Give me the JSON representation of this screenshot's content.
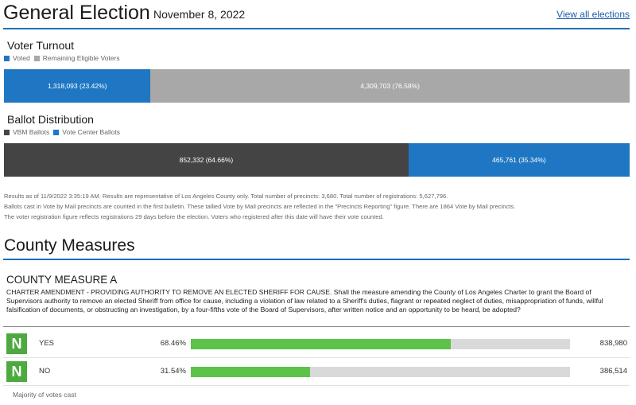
{
  "header": {
    "title": "General Election",
    "date": "November 8, 2022",
    "view_all": "View all elections"
  },
  "turnout": {
    "title": "Voter Turnout",
    "legend": [
      {
        "label": "Voted",
        "color": "#1f77c4"
      },
      {
        "label": "Remaining Eligible Voters",
        "color": "#a8a8a8"
      }
    ],
    "segments": [
      {
        "label": "1,318,093 (23.42%)",
        "fraction": 0.2342,
        "color": "#1f77c4"
      },
      {
        "label": "4,309,703 (76.58%)",
        "fraction": 0.7658,
        "color": "#a8a8a8"
      }
    ]
  },
  "distribution": {
    "title": "Ballot Distribution",
    "legend": [
      {
        "label": "VBM Ballots",
        "color": "#444444"
      },
      {
        "label": "Vote Center Ballots",
        "color": "#1f77c4"
      }
    ],
    "segments": [
      {
        "label": "852,332 (64.66%)",
        "fraction": 0.6466,
        "color": "#444444"
      },
      {
        "label": "465,761 (35.34%)",
        "fraction": 0.3534,
        "color": "#1f77c4"
      }
    ]
  },
  "notes": [
    "Results as of 11/9/2022 3:35:19 AM. Results are representative of Los Angeles County only. Total number of precincts: 3,680. Total number of registrations: 5,627,796.",
    "Ballots cast in Vote by Mail precincts are counted in the first bulletin. These tallied Vote by Mail precincts are reflected in the \"Precincts Reporting\" figure. There are 1864 Vote by Mail precincts.",
    "The voter registration figure reflects registrations 29 days before the election. Voters who registered after this date will have their vote counted."
  ],
  "measures": {
    "title": "County Measures",
    "measure": {
      "name": "COUNTY MEASURE A",
      "description": "CHARTER AMENDMENT - PROVIDING AUTHORITY TO REMOVE AN ELECTED SHERIFF FOR CAUSE. Shall the measure amending the County of Los Angeles Charter to grant the Board of Supervisors authority to remove an elected Sheriff from office for cause, including a violation of law related to a Sheriff's duties, flagrant or repeated neglect of duties, misappropriation of funds, willful falsification of documents, or obstructing an investigation, by a four-fifths vote of the Board of Supervisors, after written notice and an opportunity to be heard, be adopted?",
      "choices": [
        {
          "badge": "N",
          "label": "YES",
          "percent": "68.46%",
          "fraction": 0.6846,
          "votes": "838,980"
        },
        {
          "badge": "N",
          "label": "NO",
          "percent": "31.54%",
          "fraction": 0.3154,
          "votes": "386,514"
        }
      ],
      "footer": "Majority of votes cast"
    }
  }
}
